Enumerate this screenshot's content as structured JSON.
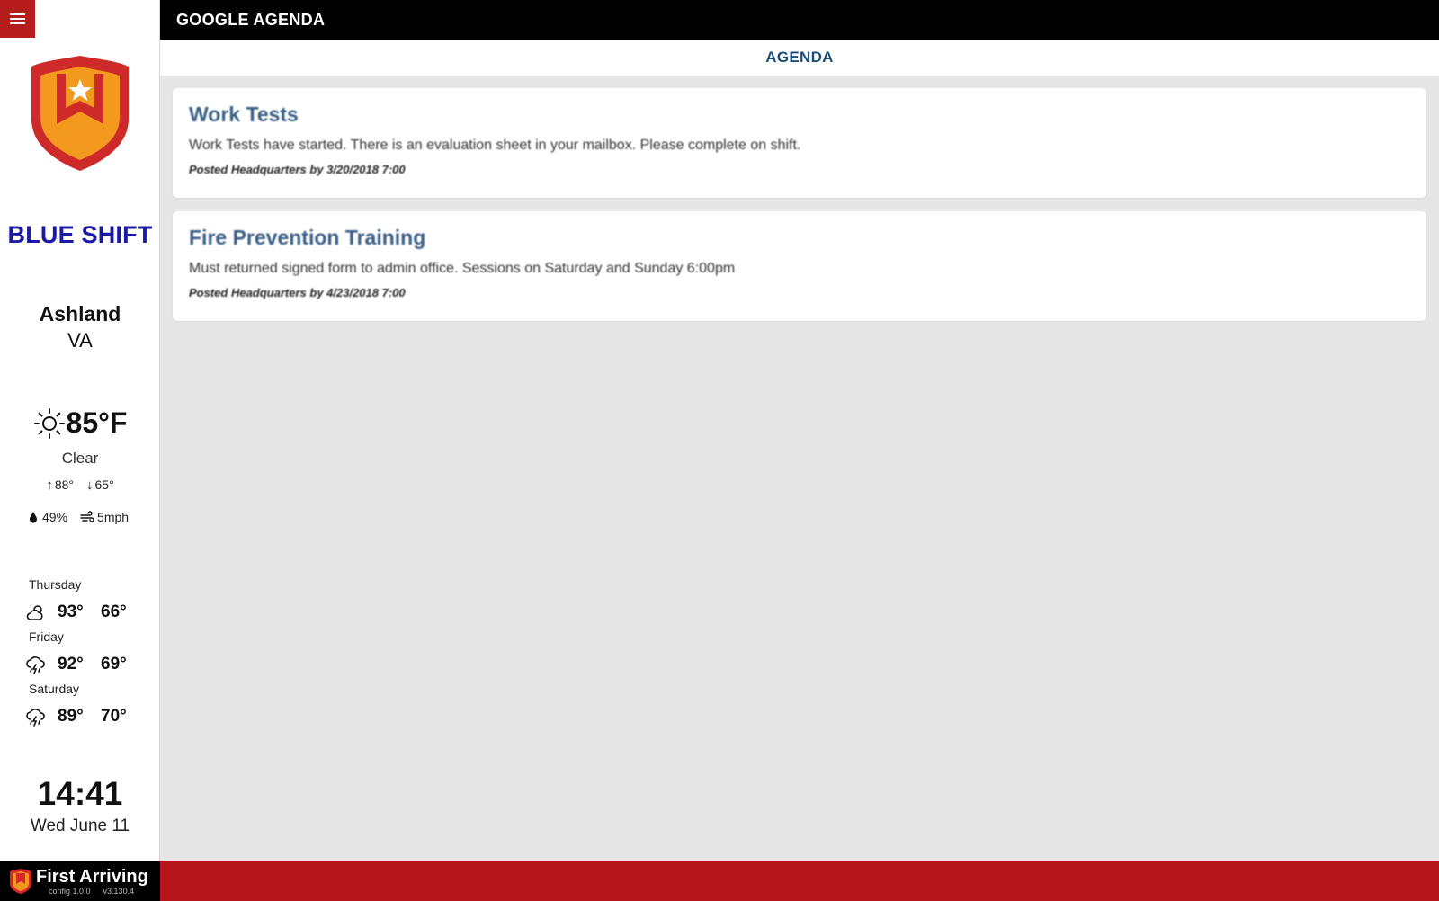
{
  "app": {
    "title": "GOOGLE AGENDA",
    "section": "AGENDA"
  },
  "sidebar": {
    "shift_name": "BLUE SHIFT",
    "location": {
      "city": "Ashland",
      "state": "VA"
    },
    "weather": {
      "icon": "sun-icon",
      "current_temp": "85°F",
      "condition": "Clear",
      "high": "88°",
      "low": "65°",
      "humidity": "49%",
      "wind": "5mph"
    },
    "forecast": [
      {
        "day": "Thursday",
        "icon": "partly-cloudy-icon",
        "high": "93°",
        "low": "66°"
      },
      {
        "day": "Friday",
        "icon": "thunderstorm-icon",
        "high": "92°",
        "low": "69°"
      },
      {
        "day": "Saturday",
        "icon": "thunderstorm-icon",
        "high": "89°",
        "low": "70°"
      }
    ],
    "clock": {
      "time": "14:41",
      "date": "Wed June 11"
    }
  },
  "agenda": [
    {
      "title": "Work Tests",
      "body": "Work Tests have started. There is an evaluation sheet in your mailbox. Please complete on shift.",
      "meta": "Posted Headquarters by 3/20/2018 7:00"
    },
    {
      "title": "Fire Prevention Training",
      "body": "Must returned signed form to admin office. Sessions on Saturday and Sunday 6:00pm",
      "meta": "Posted Headquarters by 4/23/2018 7:00"
    }
  ],
  "footer": {
    "brand": "First Arriving",
    "config_version": "config 1.0.0",
    "app_version": "v3.130.4"
  },
  "colors": {
    "accent_red": "#b5141b",
    "shift_blue": "#1a1aa6",
    "title_blue": "#1d4e79",
    "shield_orange": "#f39a1e"
  }
}
